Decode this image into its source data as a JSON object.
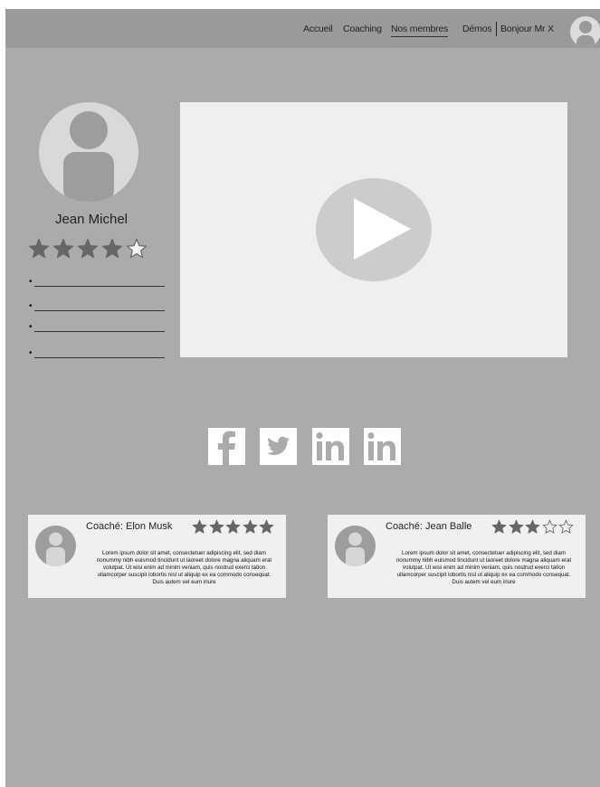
{
  "nav": {
    "items": [
      "Accueil",
      "Coaching",
      "Nos membres",
      "Démos"
    ],
    "active": "Nos membres",
    "greeting": "Bonjour Mr X"
  },
  "profile": {
    "name": "Jean Michel",
    "rating": 4,
    "rating_max": 5,
    "bullet_count": 4
  },
  "video": {
    "icon": "play-icon"
  },
  "social": [
    "facebook-icon",
    "twitter-icon",
    "linkedin-icon",
    "linkedin-icon"
  ],
  "reviews": [
    {
      "author": "Coaché: Elon Musk",
      "rating": 5,
      "rating_max": 5,
      "text": "Lorem ipsum dolor sit amet, consectetuer adipiscing elit, sed diam nonummy nibh euismod tincidunt ut laoreet dolore magna aliquam erat volutpat. Ut wisi enim ad minim veniam, quis nostrud exerci tation ullamcorper suscipit lobortis nisl ut aliquip ex ea commodo consequat. Duis autem vel eum iriure"
    },
    {
      "author": "Coaché: Jean Balle",
      "rating": 3,
      "rating_max": 5,
      "text": "Lorem ipsum dolor sit amet, consectetuer adipiscing elit, sed diam nonummy nibh euismod tincidunt ut laoreet dolore magna aliquam erat volutpat. Ut wisi enim ad minim veniam, quis nostrud exerci tation ullamcorper suscipit lobortis nisl ut aliquip ex ea commodo consequat. Duis autem vel eum iriure"
    }
  ],
  "colors": {
    "page_background": "#ababab",
    "navbar": "#9a9a9a",
    "panel": "#efefef",
    "star_filled": "#666666",
    "star_empty": "#f5f5f5"
  }
}
